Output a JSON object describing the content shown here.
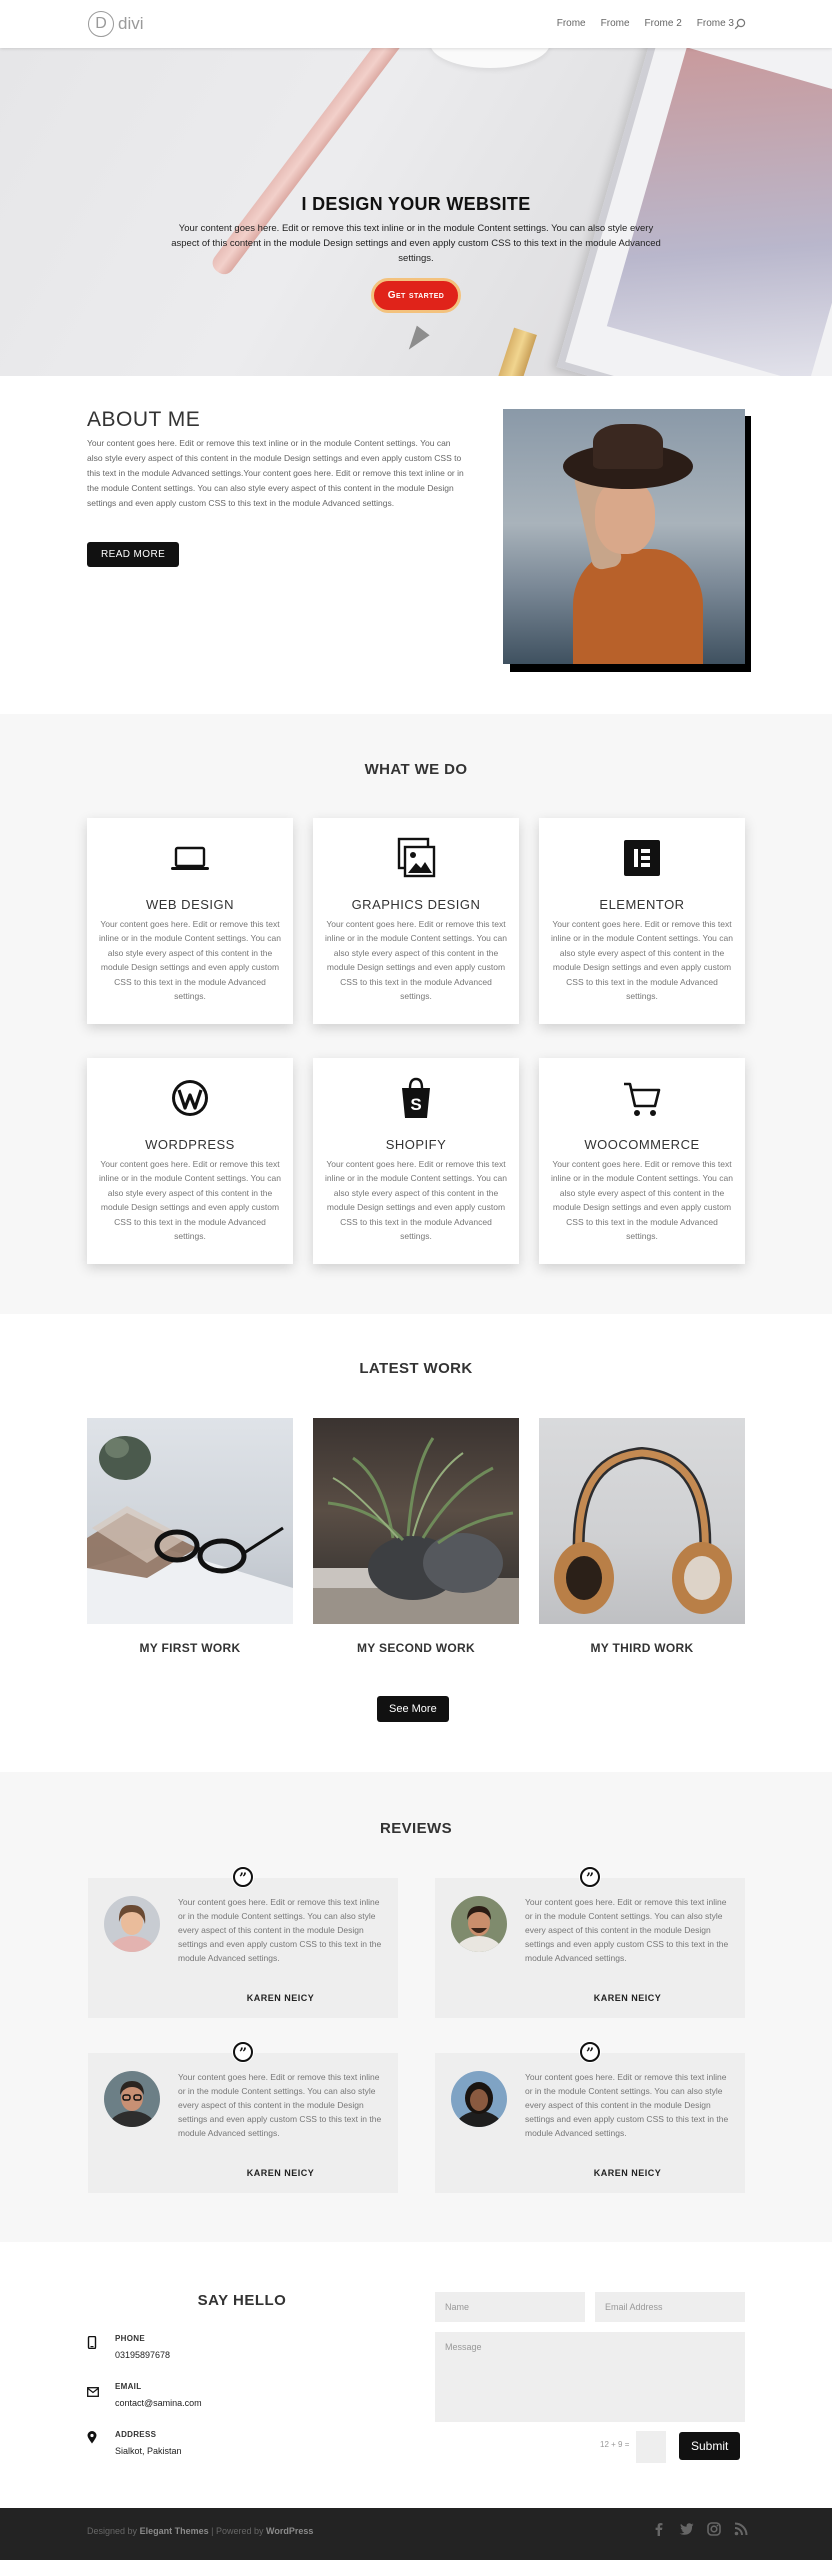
{
  "header": {
    "logo_letter": "D",
    "logo_text": "divi",
    "nav": [
      "Frome",
      "Frome",
      "Frome 2",
      "Frome 3"
    ]
  },
  "hero": {
    "title": "I DESIGN YOUR WEBSITE",
    "text": "Your content goes here. Edit or remove this text inline or in the module Content settings. You can also style every aspect of this content in the module Design settings and even apply custom CSS to this text in the module Advanced settings.",
    "button": "Get started"
  },
  "about": {
    "title": "ABOUT ME",
    "text": "Your content goes here. Edit or remove this text inline or in the module Content settings. You can also style every aspect of this content in the module Design settings and even apply custom CSS to this text in the module Advanced settings.Your content goes here. Edit or remove this text inline or in the module Content settings. You can also style every aspect of this content in the module Design settings and even apply custom CSS to this text in the module Advanced settings.",
    "button": "READ MORE"
  },
  "services": {
    "title": "WHAT WE DO",
    "items": [
      {
        "title": "WEB DESIGN",
        "icon": "laptop-icon",
        "text": "Your content goes here. Edit or remove this text inline or in the module Content settings. You can also style every aspect of this content in the module Design settings and even apply custom CSS to this text in the module Advanced settings."
      },
      {
        "title": "GRAPHICS DESIGN",
        "icon": "image-gallery-icon",
        "text": "Your content goes here. Edit or remove this text inline or in the module Content settings. You can also style every aspect of this content in the module Design settings and even apply custom CSS to this text in the module Advanced settings."
      },
      {
        "title": "ELEMENTOR",
        "icon": "elementor-icon",
        "text": "Your content goes here. Edit or remove this text inline or in the module Content settings. You can also style every aspect of this content in the module Design settings and even apply custom CSS to this text in the module Advanced settings."
      },
      {
        "title": "WORDPRESS",
        "icon": "wordpress-icon",
        "text": "Your content goes here. Edit or remove this text inline or in the module Content settings. You can also style every aspect of this content in the module Design settings and even apply custom CSS to this text in the module Advanced settings."
      },
      {
        "title": "SHOPIFY",
        "icon": "shopify-icon",
        "text": "Your content goes here. Edit or remove this text inline or in the module Content settings. You can also style every aspect of this content in the module Design settings and even apply custom CSS to this text in the module Advanced settings."
      },
      {
        "title": "WOOCOMMERCE",
        "icon": "cart-icon",
        "text": "Your content goes here. Edit or remove this text inline or in the module Content settings. You can also style every aspect of this content in the module Design settings and even apply custom CSS to this text in the module Advanced settings."
      }
    ]
  },
  "latest": {
    "title": "LATEST WORK",
    "items": [
      {
        "title": "MY FIRST WORK"
      },
      {
        "title": "MY SECOND WORK"
      },
      {
        "title": "MY THIRD WORK"
      }
    ],
    "button": "See More"
  },
  "reviews": {
    "title": "REVIEWS",
    "items": [
      {
        "name": "KAREN NEICY",
        "text": "Your content goes here. Edit or remove this text inline or in the module Content settings. You can also style every aspect of this content in the module Design settings and even apply custom CSS to this text in the module Advanced settings."
      },
      {
        "name": "KAREN NEICY",
        "text": "Your content goes here. Edit or remove this text inline or in the module Content settings. You can also style every aspect of this content in the module Design settings and even apply custom CSS to this text in the module Advanced settings."
      },
      {
        "name": "KAREN NEICY",
        "text": "Your content goes here. Edit or remove this text inline or in the module Content settings. You can also style every aspect of this content in the module Design settings and even apply custom CSS to this text in the module Advanced settings."
      },
      {
        "name": "KAREN NEICY",
        "text": "Your content goes here. Edit or remove this text inline or in the module Content settings. You can also style every aspect of this content in the module Design settings and even apply custom CSS to this text in the module Advanced settings."
      }
    ]
  },
  "contact": {
    "title": "SAY HELLO",
    "phone_label": "PHONE",
    "phone": "03195897678",
    "email_label": "EMAIL",
    "email": "contact@samina.com",
    "address_label": "ADDRESS",
    "address": "Sialkot, Pakistan",
    "form": {
      "name_placeholder": "Name",
      "email_placeholder": "Email Address",
      "message_placeholder": "Message",
      "captcha": "12 + 9 =",
      "submit": "Submit"
    }
  },
  "footer": {
    "designed_by": "Designed by",
    "elegant": "Elegant Themes",
    "powered": "| Powered by",
    "wordpress": "WordPress"
  },
  "colors": {
    "accent": "#e0231a",
    "dark": "#111111",
    "footer_bg": "#232323"
  }
}
